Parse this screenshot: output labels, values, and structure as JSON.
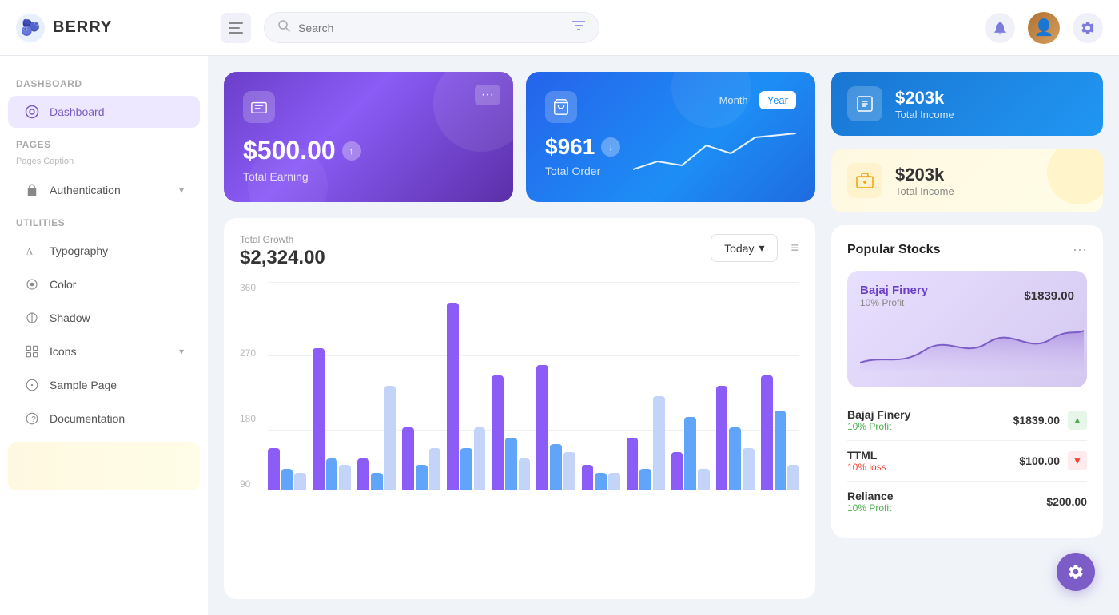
{
  "header": {
    "logo_text": "BERRY",
    "search_placeholder": "Search",
    "menu_icon": "☰",
    "bell_icon": "🔔",
    "settings_icon": "⚙"
  },
  "sidebar": {
    "dashboard_section": "Dashboard",
    "dashboard_item": "Dashboard",
    "pages_section": "Pages",
    "pages_caption": "Pages Caption",
    "auth_item": "Authentication",
    "utilities_section": "Utilities",
    "typography_item": "Typography",
    "color_item": "Color",
    "shadow_item": "Shadow",
    "icons_item": "Icons",
    "sample_page_item": "Sample Page",
    "documentation_item": "Documentation"
  },
  "earning_card": {
    "amount": "$500.00",
    "label": "Total Earning"
  },
  "order_card": {
    "amount": "$961",
    "label": "Total Order",
    "month_btn": "Month",
    "year_btn": "Year"
  },
  "right_top_blue": {
    "amount": "$203k",
    "label": "Total Income"
  },
  "right_top_yellow": {
    "amount": "$203k",
    "label": "Total Income"
  },
  "chart": {
    "section_label": "Total Growth",
    "amount": "$2,324.00",
    "period_btn": "Today",
    "y_labels": [
      "360",
      "270",
      "180",
      "90"
    ],
    "menu_icon": "≡"
  },
  "stocks": {
    "title": "Popular Stocks",
    "featured_name": "Bajaj Finery",
    "featured_price": "$1839.00",
    "featured_profit": "10% Profit",
    "items": [
      {
        "name": "Bajaj Finery",
        "price": "$1839.00",
        "profit": "10% Profit",
        "trend": "up"
      },
      {
        "name": "TTML",
        "price": "$100.00",
        "profit": "10% loss",
        "trend": "down"
      },
      {
        "name": "Reliance",
        "price": "$200.00",
        "profit": "10% Profit",
        "trend": "up"
      }
    ]
  }
}
